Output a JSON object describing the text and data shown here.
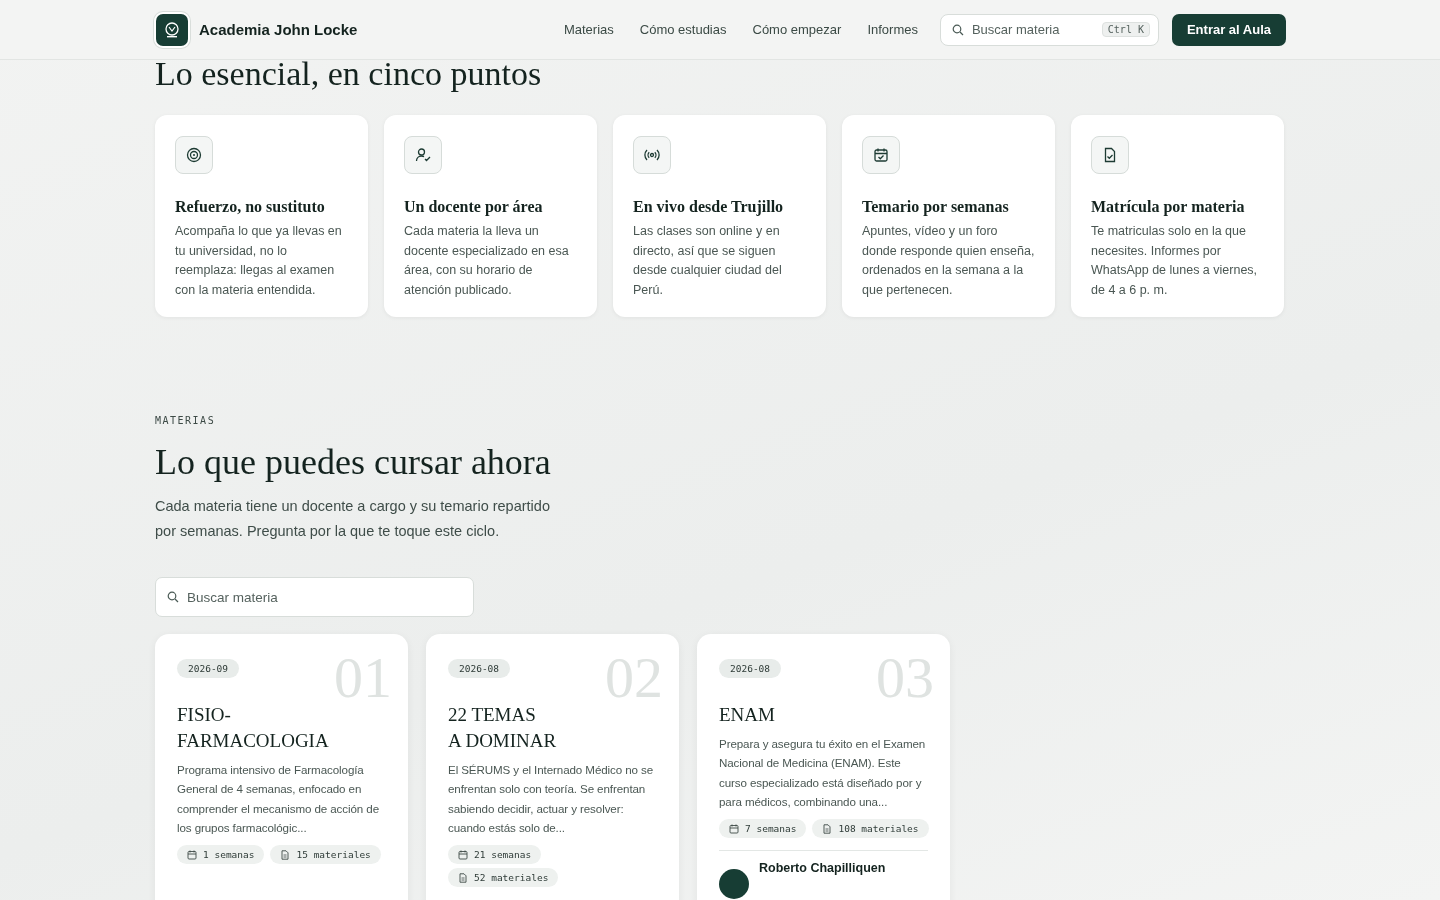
{
  "header": {
    "brand": "Academia John Locke",
    "nav": [
      {
        "label": "Materias"
      },
      {
        "label": "Cómo estudias"
      },
      {
        "label": "Cómo empezar"
      },
      {
        "label": "Informes"
      }
    ],
    "search": {
      "placeholder": "Buscar materia",
      "shortcut": "Ctrl K"
    },
    "cta": "Entrar al Aula"
  },
  "essentials": {
    "title": "Lo esencial, en cinco puntos",
    "items": [
      {
        "title": "Refuerzo, no sustituto",
        "text": "Acompaña lo que ya llevas en tu universidad, no lo reemplaza: llegas al examen con la materia entendida."
      },
      {
        "title": "Un docente por área",
        "text": "Cada materia la lleva un docente especializado en esa área, con su horario de atención publicado."
      },
      {
        "title": "En vivo desde Trujillo",
        "text": "Las clases son online y en directo, así que se siguen desde cualquier ciudad del Perú."
      },
      {
        "title": "Temario por semanas",
        "text": "Apuntes, vídeo y un foro donde responde quien enseña, ordenados en la semana a la que pertenecen."
      },
      {
        "title": "Matrícula por materia",
        "text": "Te matriculas solo en la que necesites. Informes por WhatsApp de lunes a viernes, de 4 a 6 p. m."
      }
    ]
  },
  "courses": {
    "eyebrow": "MATERIAS",
    "title": "Lo que puedes cursar ahora",
    "intro": "Cada materia tiene un docente a cargo y su temario repartido por semanas. Pregunta por la que te toque este ciclo.",
    "search": {
      "placeholder": "Buscar materia"
    },
    "items": [
      {
        "date": "2026-09",
        "number": "01",
        "title_lines": [
          "FISIO-",
          "FARMACOLOGIA"
        ],
        "text": "Programa intensivo de Farmacología General de 4 semanas, enfocado en comprender el mecanismo de acción de los grupos farmacológic...",
        "weeks": "1 semanas",
        "materials": "15 materiales"
      },
      {
        "date": "2026-08",
        "number": "02",
        "title_lines": [
          "22 TEMAS",
          "A DOMINAR"
        ],
        "text": "El SÉRUMS y el Internado Médico no se enfrentan solo con teoría. Se enfrentan sabiendo decidir, actuar y resolver: cuando estás solo de...",
        "weeks": "21 semanas",
        "materials": "52 materiales"
      },
      {
        "date": "2026-08",
        "number": "03",
        "title_lines": [
          "ENAM"
        ],
        "text": "Prepara y asegura tu éxito en el Examen Nacional de Medicina (ENAM). Este curso especializado está diseñado por y para médicos, combinando una...",
        "weeks": "7 semanas",
        "materials": "108 materiales",
        "teacher": "Roberto Chapilliquen"
      }
    ]
  }
}
